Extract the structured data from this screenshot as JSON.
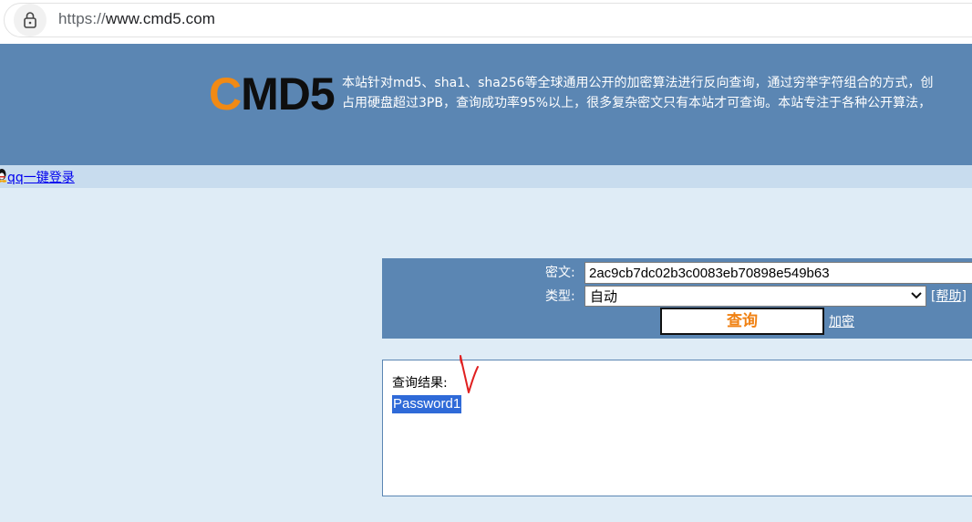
{
  "browser": {
    "url_scheme": "https://",
    "url_host": "www.cmd5.com"
  },
  "header": {
    "logo_first": "C",
    "logo_rest": "MD5",
    "intro_line1": "本站针对md5、sha1、sha256等全球通用公开的加密算法进行反向查询，通过穷举字符组合的方式，创",
    "intro_line2": "占用硬盘超过3PB，查询成功率95%以上，很多复杂密文只有本站才可查询。本站专注于各种公开算法，"
  },
  "login": {
    "qq_link": "qq一键登录"
  },
  "query": {
    "cipher_label": "密文:",
    "cipher_value": "2ac9cb7dc02b3c0083eb70898e549b63",
    "type_label": "类型:",
    "type_value": "自动",
    "help_link": "[帮助]",
    "query_button": "查询",
    "encrypt_link": "加密"
  },
  "result": {
    "label": "查询结果:",
    "value": "Password1"
  },
  "colors": {
    "header_bg": "#5b86b3",
    "accent_orange": "#f08214",
    "selection_blue": "#2f6ad8",
    "page_bg": "#dfecf6"
  }
}
